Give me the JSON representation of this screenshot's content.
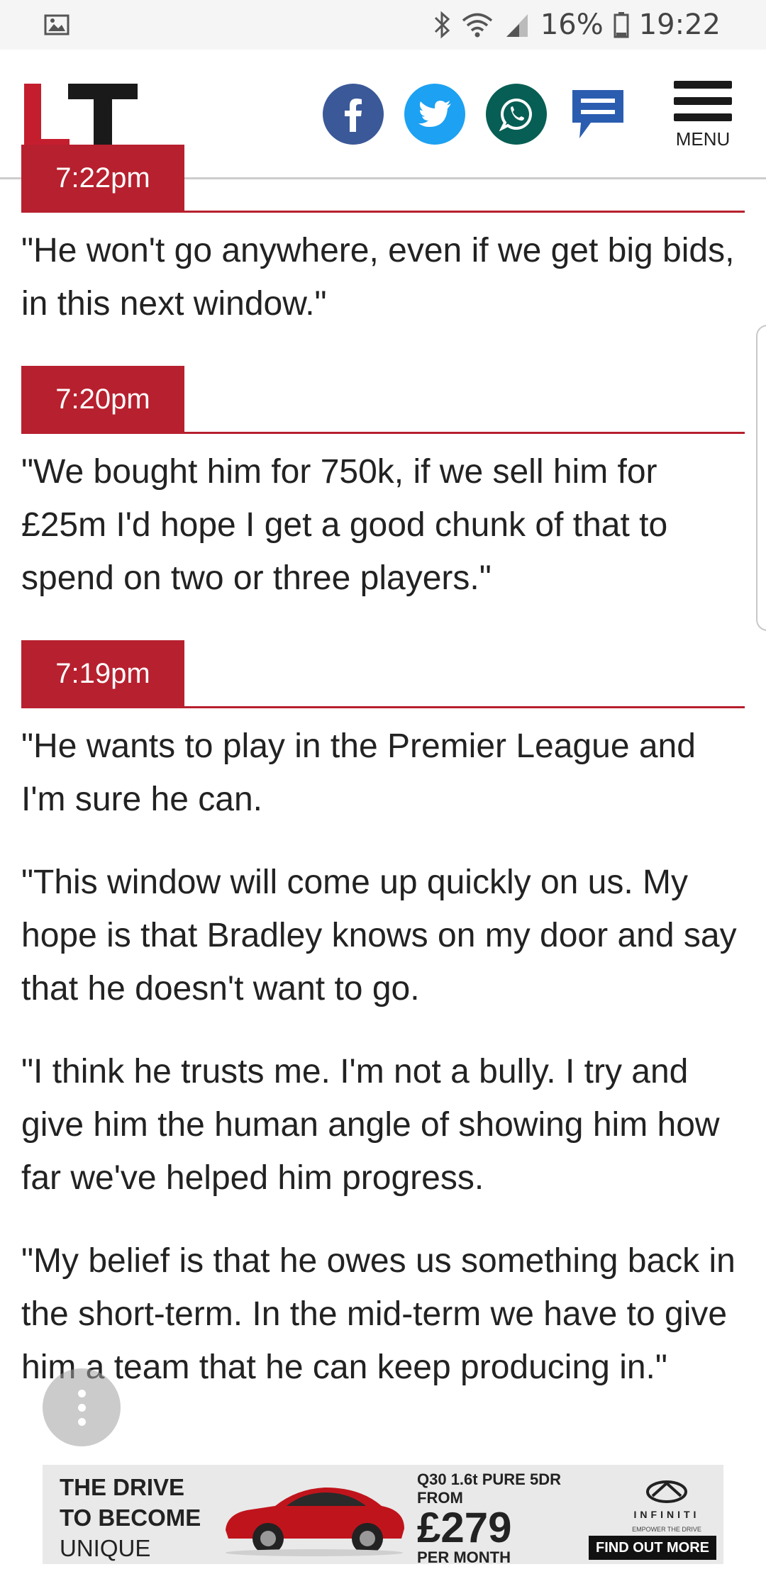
{
  "status_bar": {
    "battery_percent": "16%",
    "time": "19:22",
    "icons": [
      "image-icon",
      "bluetooth-icon",
      "wifi-icon",
      "signal-icon",
      "battery-icon"
    ]
  },
  "header": {
    "logo_text": "LT",
    "share_buttons": [
      {
        "name": "facebook",
        "color": "#3b5998"
      },
      {
        "name": "twitter",
        "color": "#1da1f2"
      },
      {
        "name": "whatsapp",
        "color": "#075e54"
      },
      {
        "name": "comments",
        "color": "#2a5db0"
      }
    ],
    "menu_label": "MENU"
  },
  "entries": [
    {
      "time": "7:22pm",
      "paragraphs": [
        "\"He won't go anywhere, even if we get big bids, in this next window.\""
      ]
    },
    {
      "time": "7:20pm",
      "paragraphs": [
        "\"We bought him for 750k, if we sell him for £25m I'd hope I get a good chunk of that to spend on two or three players.\""
      ]
    },
    {
      "time": "7:19pm",
      "paragraphs": [
        "\"He wants to play in the Premier League and I'm sure he can.",
        "\"This window will come up quickly on us. My hope is that Bradley knows on my door and say that he doesn't want to go.",
        "\"I think he trusts me. I'm not a bully. I try and give him the human angle of showing him how far we've helped him progress.",
        "\"My belief is that he owes us something back in the short-term. In the mid-term we have to give him a team that he can keep producing in.\""
      ]
    }
  ],
  "ad": {
    "slogan_line1": "THE DRIVE",
    "slogan_line2": "TO BECOME",
    "slogan_line3": "UNIQUE",
    "model": "Q30 1.6t PURE 5DR",
    "from_label": "FROM",
    "price": "£279",
    "per_month": "PER MONTH",
    "brand": "INFINITI",
    "tagline": "EMPOWER THE DRIVE",
    "cta": "FIND OUT MORE"
  },
  "colors": {
    "accent": "#b7202e",
    "text": "#222222"
  }
}
